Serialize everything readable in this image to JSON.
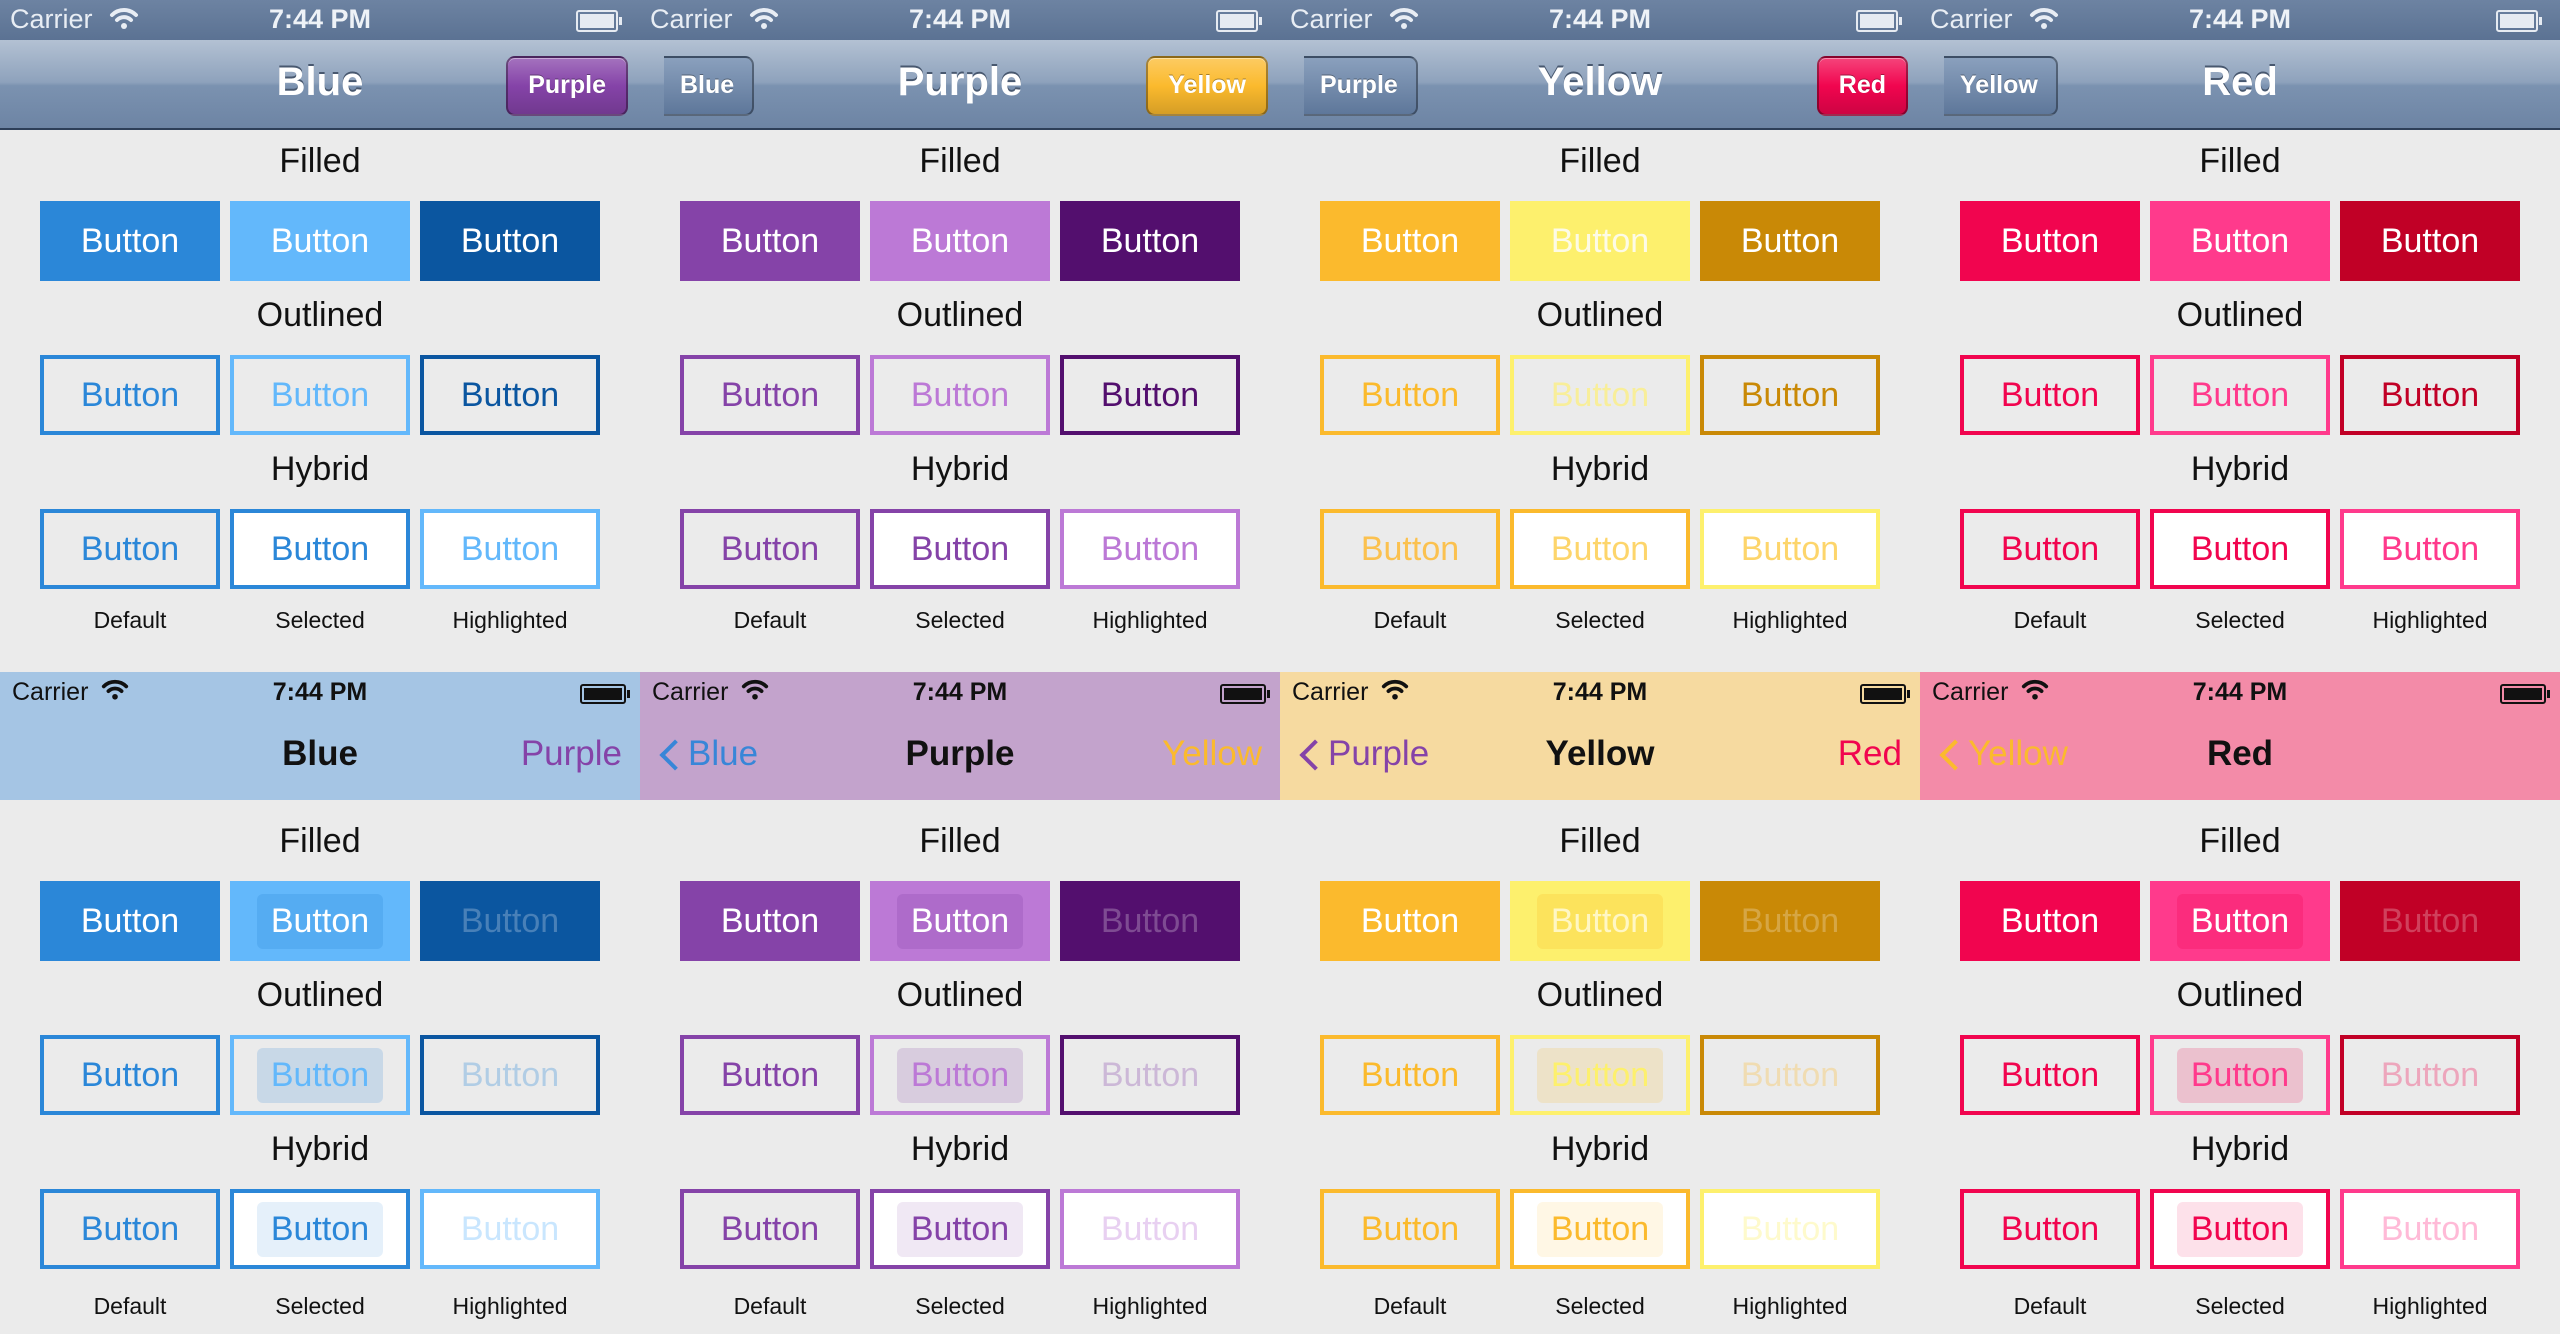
{
  "status": {
    "carrier": "Carrier",
    "time": "7:44 PM"
  },
  "button_label": "Button",
  "sections": [
    "Filled",
    "Outlined",
    "Hybrid"
  ],
  "states": [
    "Default",
    "Selected",
    "Highlighted"
  ],
  "themes": [
    {
      "name": "Blue",
      "back": "",
      "next": "Purple",
      "colors": {
        "base": "#2b87d8",
        "light": "#63b8fb",
        "dark": "#0b56a0",
        "nav7": "#a5c5e4",
        "text7": "#3886d8",
        "bar6": "#5a3e8e"
      }
    },
    {
      "name": "Purple",
      "back": "Blue",
      "next": "Yellow",
      "colors": {
        "base": "#8543a8",
        "light": "#bc79d6",
        "dark": "#530f6e",
        "nav7": "#c3a3cc",
        "text7": "#8543a8",
        "bar6": "#f7a02c"
      }
    },
    {
      "name": "Yellow",
      "back": "Purple",
      "next": "Red",
      "colors": {
        "base": "#fbba2d",
        "light": "#fdf06d",
        "dark": "#c98906",
        "nav7": "#f6daa0",
        "text7": "#fbba2d",
        "bar6": "#e0162f"
      }
    },
    {
      "name": "Red",
      "back": "Yellow",
      "next": "",
      "colors": {
        "base": "#f1054f",
        "light": "#ff3a8c",
        "dark": "#c10026",
        "nav7": "#f38ba8",
        "text7": "#f1054f",
        "bar6": ""
      }
    }
  ],
  "nav_button_colors": {
    "Purple": "#7a3fa3",
    "Yellow": "#f5ad2e",
    "Red": "#e0182f",
    "Blue": "#5a73a0"
  }
}
